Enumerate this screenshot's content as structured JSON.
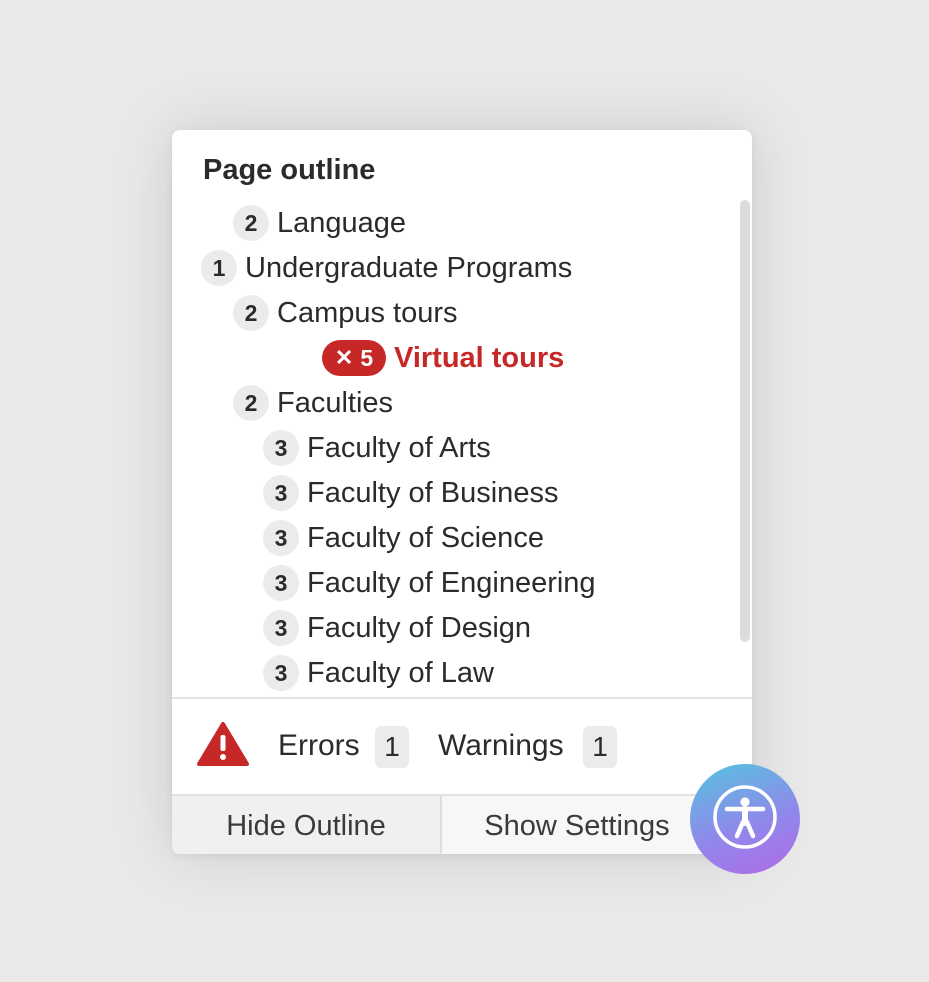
{
  "panel": {
    "title": "Page outline"
  },
  "outline": {
    "items": [
      {
        "level": "2",
        "label": "Language"
      },
      {
        "level": "1",
        "label": "Undergraduate Programs"
      },
      {
        "level": "2",
        "label": "Campus tours"
      },
      {
        "level": "5",
        "label": "Virtual tours",
        "error": true
      },
      {
        "level": "2",
        "label": "Faculties"
      },
      {
        "level": "3",
        "label": "Faculty of Arts"
      },
      {
        "level": "3",
        "label": "Faculty of Business"
      },
      {
        "level": "3",
        "label": "Faculty of Science"
      },
      {
        "level": "3",
        "label": "Faculty of Engineering"
      },
      {
        "level": "3",
        "label": "Faculty of Design"
      },
      {
        "level": "3",
        "label": "Faculty of Law"
      }
    ],
    "error_icon": "close-icon"
  },
  "status": {
    "errors_label": "Errors",
    "errors_count": "1",
    "warnings_label": "Warnings",
    "warnings_count": "1",
    "warning_icon": "warning-triangle-icon"
  },
  "buttons": {
    "hide_outline": "Hide Outline",
    "show_settings": "Show Settings"
  },
  "fab": {
    "icon": "accessibility-icon"
  },
  "colors": {
    "error": "#c62828",
    "badge_bg": "#ebebeb",
    "fab_gradient_start": "#55c4e0",
    "fab_gradient_end": "#b06ae8"
  }
}
